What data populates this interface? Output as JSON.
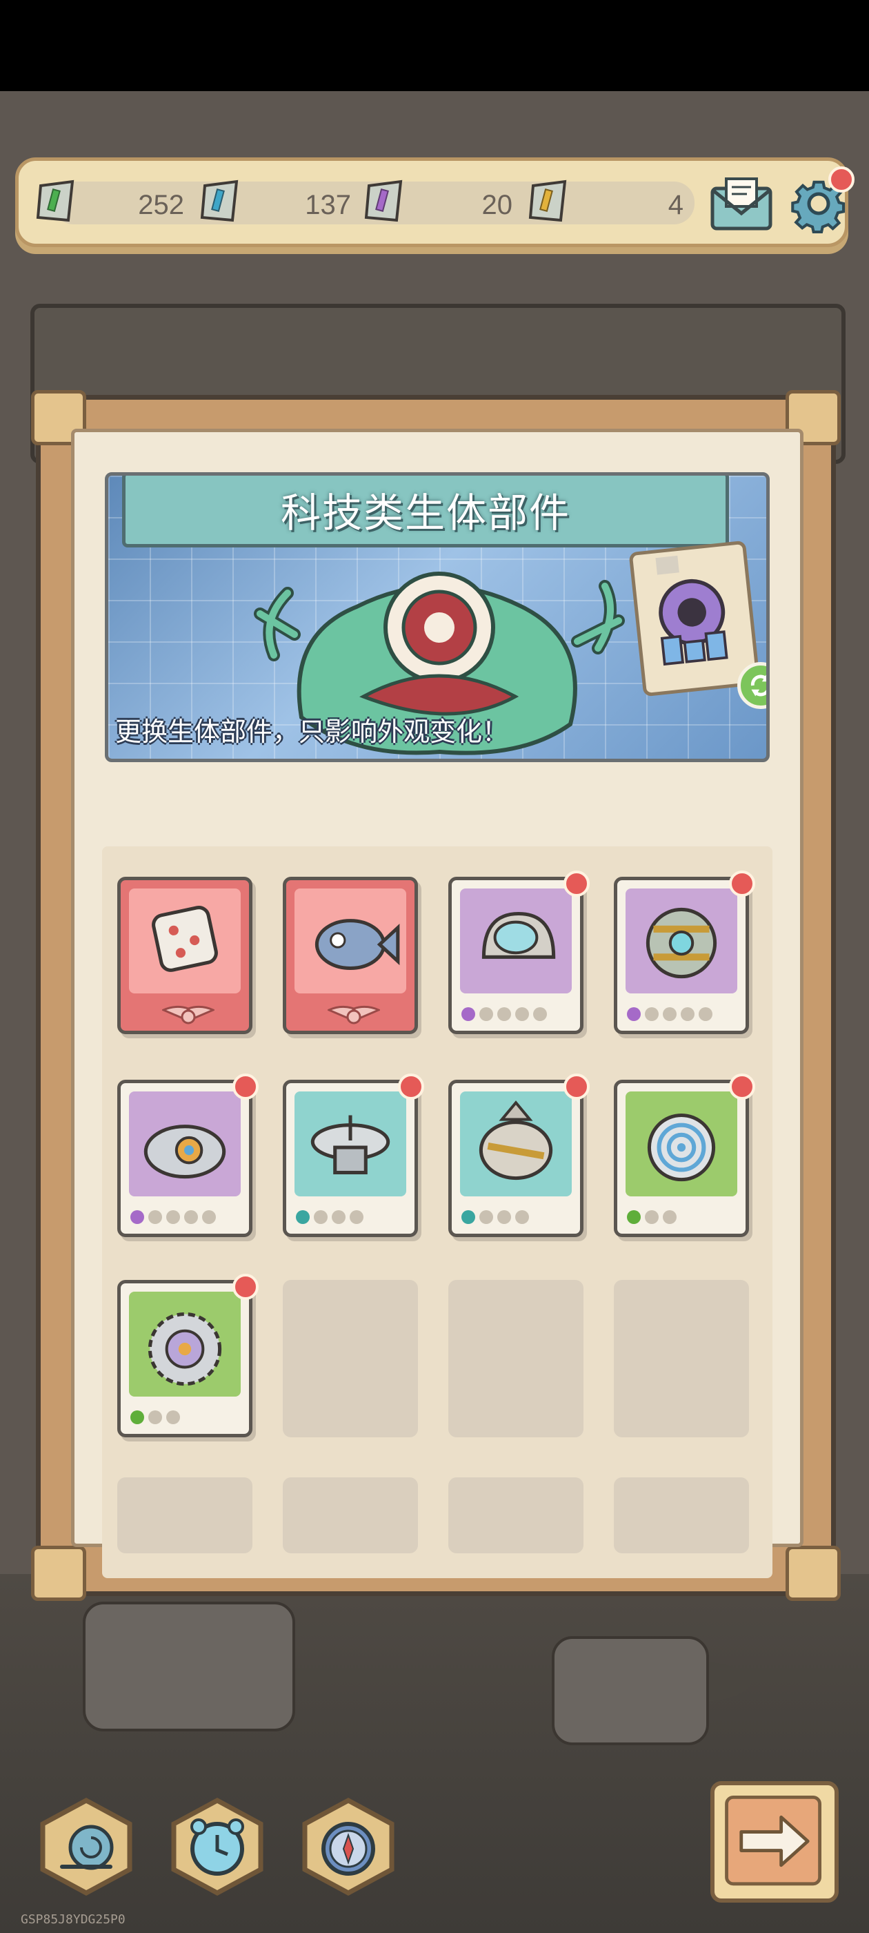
{
  "currency": {
    "items": [
      {
        "icon": "green-ticket-icon",
        "value": "252"
      },
      {
        "icon": "blue-ticket-icon",
        "value": "137"
      },
      {
        "icon": "purple-ticket-icon",
        "value": "20"
      },
      {
        "icon": "gold-ticket-icon",
        "value": "4"
      }
    ],
    "mail_icon": "mail-icon",
    "settings_icon": "gear-icon"
  },
  "banner": {
    "title": "科技类生体部件",
    "caption": "更换生体部件，只影响外观变化！"
  },
  "parts": [
    {
      "rarity": "red",
      "dots": 0,
      "filled": 0,
      "badge": false,
      "equipped": true,
      "color": "#e47574",
      "art": "dice"
    },
    {
      "rarity": "red",
      "dots": 0,
      "filled": 0,
      "badge": false,
      "equipped": true,
      "color": "#e47574",
      "art": "fish"
    },
    {
      "rarity": "purple",
      "dots": 5,
      "filled": 1,
      "badge": true,
      "color": "#c9a7d6",
      "art": "helmet"
    },
    {
      "rarity": "purple",
      "dots": 5,
      "filled": 1,
      "badge": true,
      "color": "#c9a7d6",
      "art": "armor-ball"
    },
    {
      "rarity": "purple",
      "dots": 5,
      "filled": 1,
      "badge": true,
      "color": "#c9a7d6",
      "art": "gear-ball"
    },
    {
      "rarity": "teal",
      "dots": 4,
      "filled": 1,
      "badge": true,
      "color": "#8fd3ce",
      "art": "radar"
    },
    {
      "rarity": "teal",
      "dots": 4,
      "filled": 1,
      "badge": true,
      "color": "#8fd3ce",
      "art": "drill"
    },
    {
      "rarity": "green",
      "dots": 3,
      "filled": 1,
      "badge": true,
      "color": "#9ccb6c",
      "art": "spiral"
    },
    {
      "rarity": "green",
      "dots": 3,
      "filled": 1,
      "badge": true,
      "color": "#9ccb6c",
      "art": "saw"
    }
  ],
  "empty_slots": 7,
  "bottom_buttons": [
    "snail-icon",
    "alarm-clock-icon",
    "compass-icon",
    "arrow-right-icon"
  ],
  "watermark": "GSP85J8YDG25P0"
}
